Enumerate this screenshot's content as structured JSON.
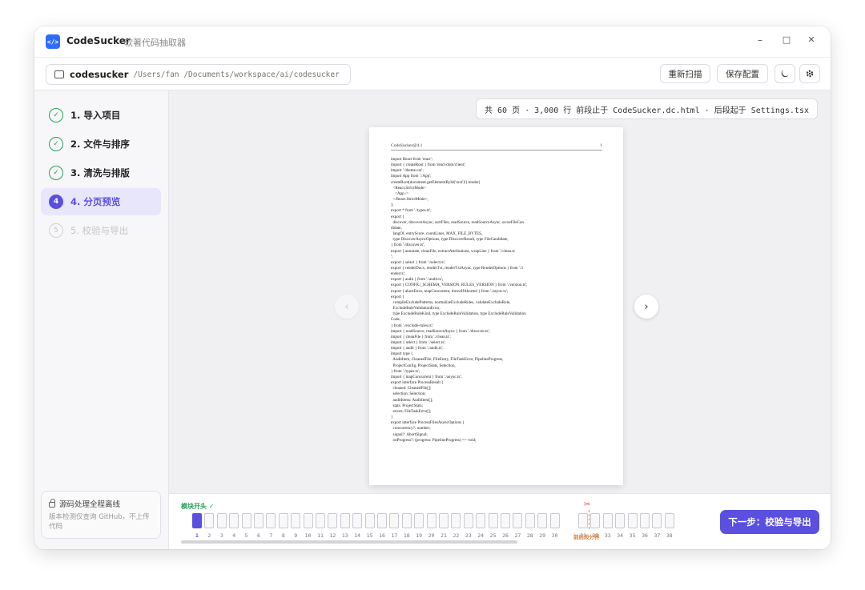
{
  "app": {
    "logo_text": "</>",
    "name": "CodeSucker",
    "subtitle": "软著代码抽取器",
    "window_controls": {
      "minimize": "–",
      "maximize": "□",
      "close": "✕"
    }
  },
  "toolbar": {
    "project_name": "codesucker",
    "project_path": "/Users/fan       /Documents/workspace/ai/codesucker",
    "rescan_label": "重新扫描",
    "save_config_label": "保存配置",
    "theme_icon": "moon-icon",
    "settings_icon": "gear-icon"
  },
  "sidebar": {
    "steps": [
      {
        "num": "1",
        "label": "1. 导入项目",
        "status": "done"
      },
      {
        "num": "2",
        "label": "2. 文件与排序",
        "status": "done"
      },
      {
        "num": "3",
        "label": "3. 清洗与排版",
        "status": "done"
      },
      {
        "num": "4",
        "label": "4. 分页预览",
        "status": "current"
      },
      {
        "num": "5",
        "label": "5. 校验与导出",
        "status": "pending"
      }
    ],
    "check_glyph": "✓",
    "offline": {
      "title": "源码处理全程离线",
      "desc": "版本检测仅查询 GitHub，不上传代码"
    }
  },
  "preview": {
    "summary": "共 60 页 · 3,000 行 前段止于 CodeSucker.dc.html · 后段起于 Settings.tsx",
    "prev_arrow": "‹",
    "next_arrow": "›",
    "page_header_left": "CodeSucker@4.1",
    "page_header_right": "1",
    "code_lines": [
      "import React from 'react';",
      "import { createRoot } from 'react-dom/client';",
      "import './theme.css';",
      "import App from './App';",
      "createRoot(document.getElementById('root')!).render(",
      "  <React.StrictMode>",
      "    <App />",
      "  </React.StrictMode>,",
      ");",
      "export * from './types.ts';",
      "export {",
      "  discover, discoverAsync, sortFiles, readSource, readSourceAsync, scoreFileCan",
      "didate,",
      "  langOf, entryScore, countLines, MAX_FILE_BYTES,",
      "  type DiscoverAsyncOptions, type DiscoverResult, type FileCandidate,",
      "} from './discover.ts';",
      "export { annotate, cleanFile, extractAttributions, wrapLine } from './clean.ts",
      "';",
      "export { select } from './select.ts';",
      "export { renderDocx, renderTxt, renderTxtAsync, type RenderOptions } from './r",
      "ender.ts';",
      "export { audit } from './audit.ts';",
      "export { CONFIG_SCHEMA_VERSION, RULES_VERSION } from './version.ts';",
      "export { abortError, mapConcurrent, throwIfAborted } from './async.ts';",
      "export {",
      "  compileExcludePatterns, normalizeExcludeRules, validateExcludeRule,",
      "  ExcludeRuleValidationError,",
      "  type ExcludeRuleKind, type ExcludeRuleValidation, type ExcludeRuleValidation",
      "Code,",
      "} from './exclude-rules.ts';",
      "import { readSource, readSourceAsync } from './discover.ts';",
      "import { cleanFile } from './clean.ts';",
      "import { select } from './select.ts';",
      "import { audit } from './audit.ts';",
      "import type {",
      "  AuditItem, CleanedFile, FileEntry, FileTaskError, PipelineProgress,",
      "  ProjectConfig, ProjectStats, Selection,",
      "} from './types.ts';",
      "import { mapConcurrent } from './async.ts';",
      "export interface ProcessResult {",
      "  cleaned: CleanedFile[];",
      "  selection: Selection;",
      "  auditItems: AuditItem[];",
      "  stats: ProjectStats;",
      "  errors: FileTaskError[];",
      "}",
      "export interface ProcessFilesAsyncOptions {",
      "  concurrency?: number;",
      "  signal?: AbortSignal;",
      "  onProgress?: (progress: PipelineProgress) => void;"
    ]
  },
  "pager": {
    "start_label": "模块开头 ✓",
    "boundary_label": "前后段分界",
    "boundary_icon": "scissors-icon",
    "current_page": 1,
    "boundary_after_page": 30,
    "pages": [
      "1",
      "2",
      "3",
      "4",
      "5",
      "6",
      "7",
      "8",
      "9",
      "10",
      "11",
      "12",
      "13",
      "14",
      "15",
      "16",
      "17",
      "18",
      "19",
      "20",
      "21",
      "22",
      "23",
      "24",
      "25",
      "26",
      "27",
      "28",
      "29",
      "30",
      "31",
      "32",
      "33",
      "34",
      "35",
      "36",
      "37",
      "38"
    ],
    "next_label": "下一步：校验与导出"
  }
}
